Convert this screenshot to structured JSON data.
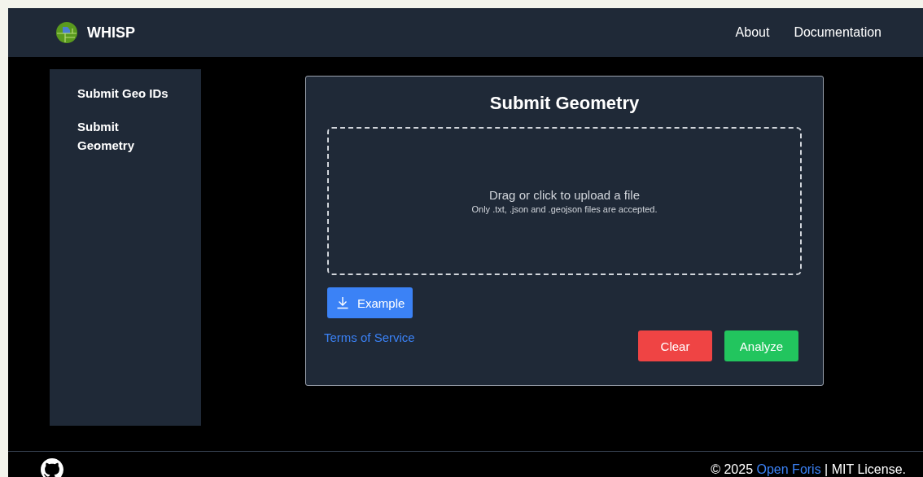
{
  "header": {
    "brand": "WHISP",
    "nav": [
      "About",
      "Documentation"
    ]
  },
  "sidebar": {
    "items": [
      "Submit Geo IDs",
      "Submit Geometry"
    ]
  },
  "form": {
    "title": "Submit Geometry",
    "dropzone": {
      "prompt": "Drag or click to upload a file",
      "hint": "Only .txt, .json and .geojson files are accepted."
    },
    "example_button": "Example",
    "terms_link": "Terms of Service",
    "buttons": [
      {
        "label": "Clear",
        "kind": "danger"
      },
      {
        "label": "Analyze",
        "kind": "success"
      }
    ]
  },
  "footer": {
    "before": "© 2025 ",
    "link": "Open Foris",
    "after": " | MIT License."
  }
}
